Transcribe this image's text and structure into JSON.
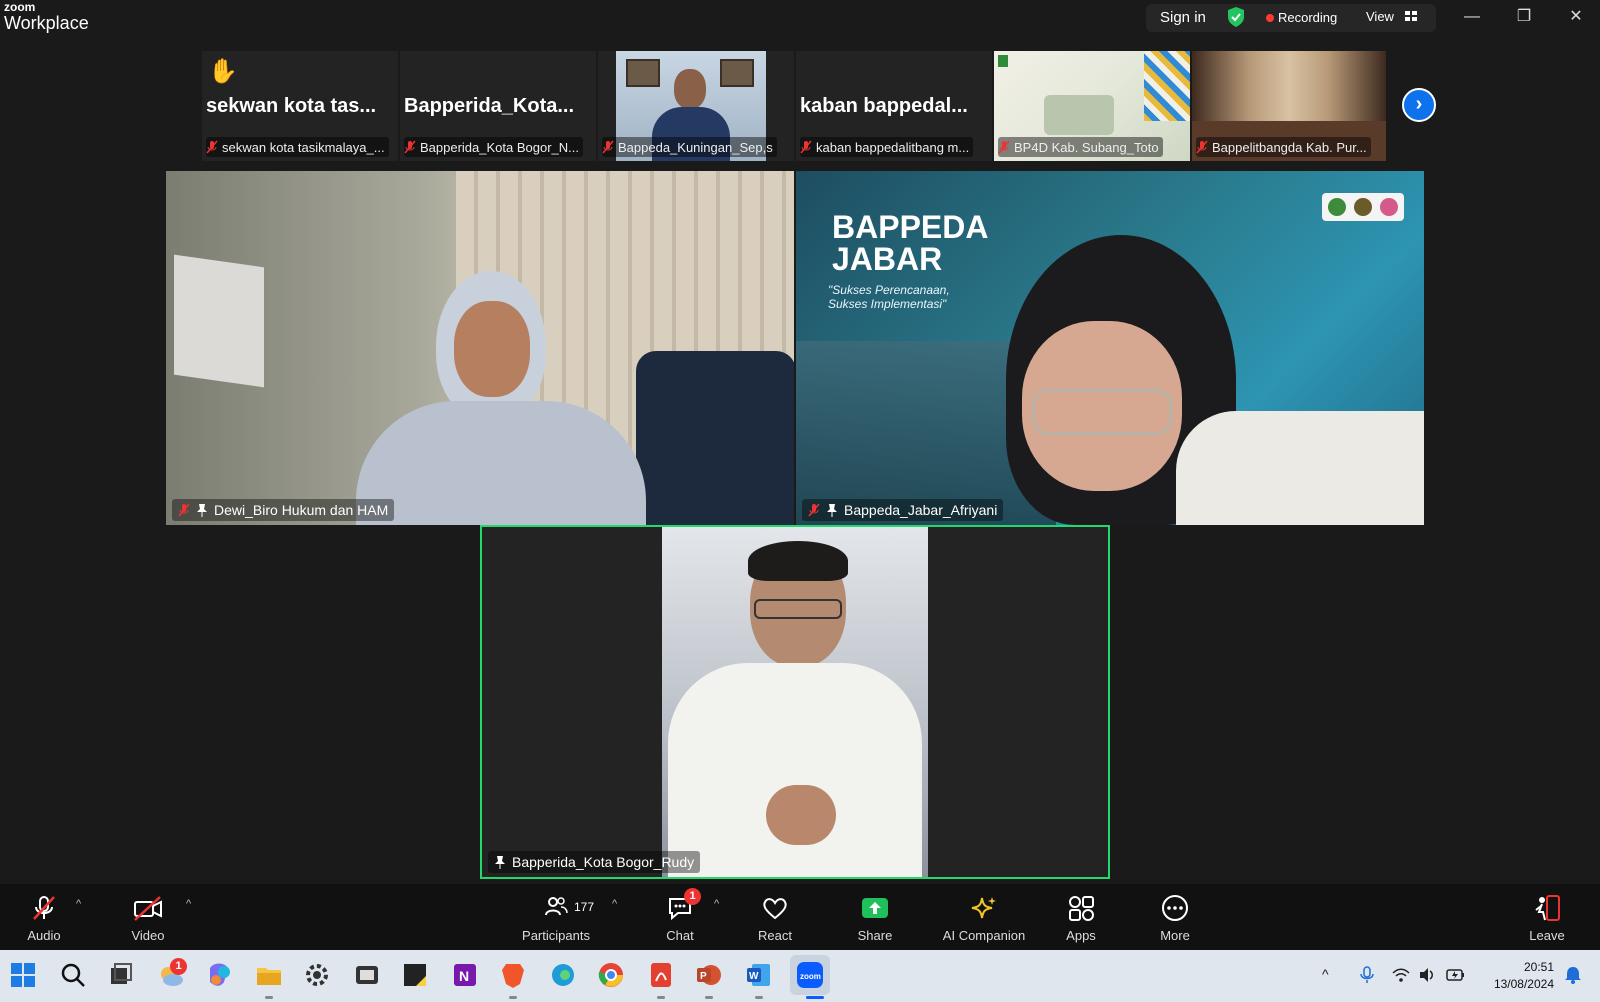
{
  "app": {
    "brand_small": "zoom",
    "brand_large": "Workplace"
  },
  "titlebar": {
    "sign_in": "Sign in",
    "recording": "Recording",
    "view": "View"
  },
  "strip": {
    "tiles": [
      {
        "big": "sekwan kota tas...",
        "caption": "sekwan kota tasikmalaya_..."
      },
      {
        "big": "Bapperida_Kota...",
        "caption": "Bapperida_Kota Bogor_N..."
      },
      {
        "big": "",
        "caption": "Bappeda_Kuningan_Sep,s"
      },
      {
        "big": "kaban bappedal...",
        "caption": "kaban bappedalitbang m..."
      },
      {
        "big": "",
        "caption": "BP4D Kab. Subang_Toto"
      },
      {
        "big": "",
        "caption": "Bappelitbangda Kab. Pur..."
      }
    ]
  },
  "videos": {
    "v1": {
      "name": "Dewi_Biro Hukum dan HAM"
    },
    "v2": {
      "name": "Bappeda_Jabar_Afriyani",
      "banner_title_1": "BAPPEDA",
      "banner_title_2": "JABAR",
      "banner_tagline_1": "\"Sukses Perencanaan,",
      "banner_tagline_2": "Sukses Implementasi\""
    },
    "v3": {
      "name": "Bapperida_Kota Bogor_Rudy"
    }
  },
  "toolbar": {
    "audio": "Audio",
    "video": "Video",
    "participants": "Participants",
    "participants_count": "177",
    "chat": "Chat",
    "chat_badge": "1",
    "react": "React",
    "share": "Share",
    "ai": "AI Companion",
    "apps": "Apps",
    "more": "More",
    "leave": "Leave"
  },
  "taskbar": {
    "time": "20:51",
    "date": "13/08/2024",
    "weather_badge": "1"
  },
  "colors": {
    "accent": "#0e72ed",
    "active_border": "#23d96e",
    "record": "#ff3b30",
    "share": "#1fbf5b"
  }
}
